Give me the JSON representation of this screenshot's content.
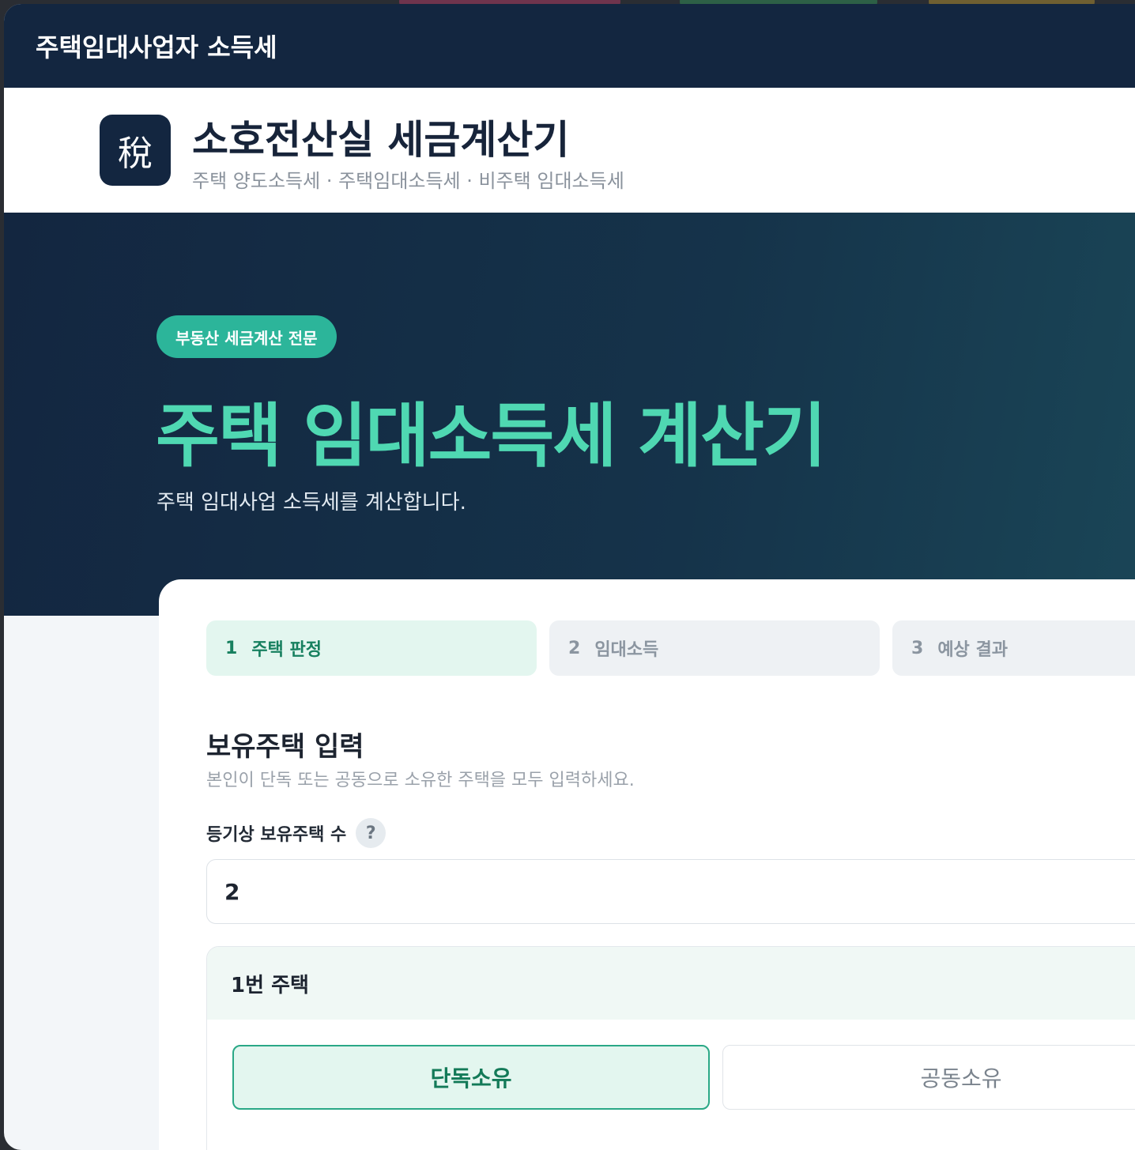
{
  "window": {
    "title": "주택임대사업자 소득세"
  },
  "brand": {
    "logo_glyph": "稅",
    "name": "소호전산실 세금계산기",
    "subtitle": "주택 양도소득세 · 주택임대소득세 · 비주택 임대소득세"
  },
  "hero": {
    "badge": "부동산 세금계산 전문",
    "title": "주택 임대소득세 계산기",
    "description": "주택 임대사업 소득세를 계산합니다."
  },
  "steps": [
    {
      "num": "1",
      "label": "주택 판정",
      "active": true
    },
    {
      "num": "2",
      "label": "임대소득",
      "active": false
    },
    {
      "num": "3",
      "label": "예상 결과",
      "active": false
    }
  ],
  "form": {
    "section_title": "보유주택 입력",
    "section_desc": "본인이 단독 또는 공동으로 소유한 주택을 모두 입력하세요.",
    "count_label": "등기상 보유주택 수",
    "help_glyph": "?",
    "count_value": "2",
    "house": {
      "title": "1번 주택",
      "ownership_options": [
        "단독소유",
        "공동소유"
      ],
      "selected": "단독소유"
    }
  },
  "colors": {
    "navy": "#132640",
    "accent": "#4fd8b2",
    "badge": "#2cb59a",
    "active_step_bg": "#e3f6ef"
  }
}
